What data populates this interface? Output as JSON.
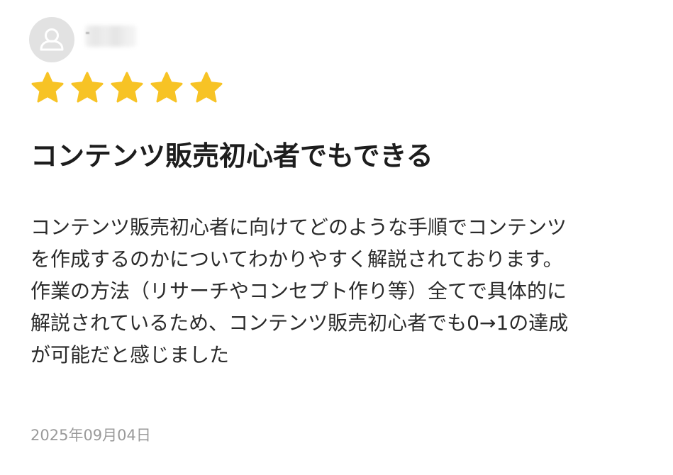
{
  "review": {
    "user": {
      "avatar_icon": "user-silhouette-icon",
      "name_visible": false
    },
    "rating": {
      "value": 5,
      "max": 5,
      "star_color": "#f7c325"
    },
    "title": "コンテンツ販売初心者でもできる",
    "body_lines": [
      "コンテンツ販売初心者に向けてどのような手順でコンテンツ",
      "を作成するのかについてわかりやすく解説されております。",
      "作業の方法（リサーチやコンセプト作り等）全てで具体的に",
      "解説されているため、コンテンツ販売初心者でも0→1の達成",
      "が可能だと感じました"
    ],
    "date": "2025年09月04日"
  }
}
